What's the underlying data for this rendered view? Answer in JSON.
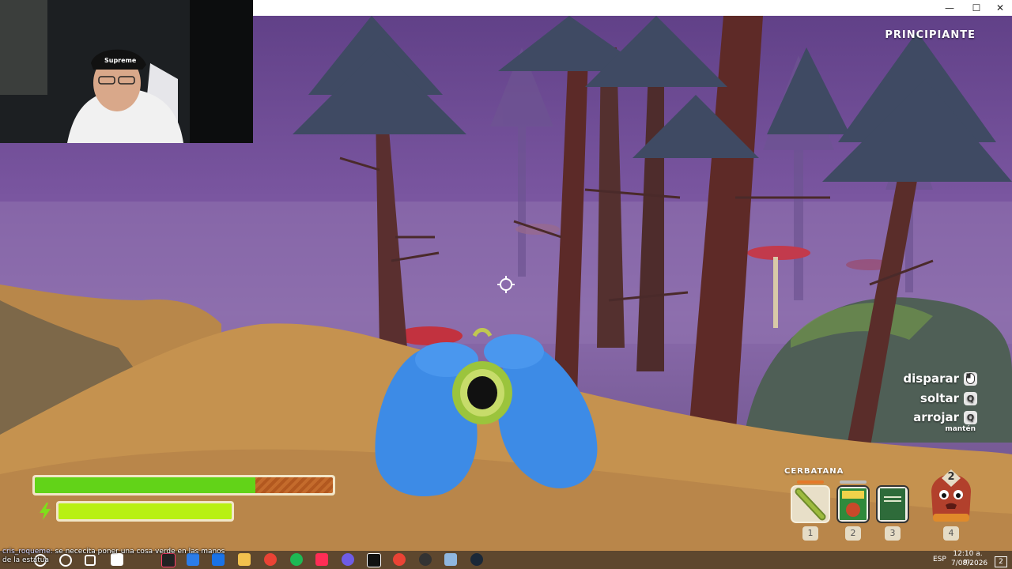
{
  "window": {
    "minimize_glyph": "—",
    "maximize_glyph": "☐",
    "close_glyph": "✕"
  },
  "hud": {
    "difficulty": "PRINCIPIANTE",
    "health_fraction": 0.74,
    "stamina_fraction": 1.0,
    "controls": [
      {
        "label": "disparar",
        "key": "mouse-left-icon"
      },
      {
        "label": "soltar",
        "key": "Q"
      },
      {
        "label": "arrojar",
        "key": "Q",
        "sub": "mantén"
      }
    ],
    "inventory": {
      "selected_name": "CERBATANA",
      "slots": [
        {
          "number": "1",
          "icon": "blowgun-icon",
          "selected": true
        },
        {
          "number": "2",
          "icon": "comic-book-icon",
          "selected": false
        },
        {
          "number": "3",
          "icon": "green-book-icon",
          "selected": false
        },
        {
          "number": "4",
          "icon": "backpack-character-icon",
          "selected": false,
          "count": "2"
        }
      ]
    }
  },
  "chat": {
    "username": "cris_roqueme:",
    "message": "se nececita poner una cosa verde en las manos de la estatua"
  },
  "taskbar": {
    "tray_lang": "ESP",
    "time": "12:10 a. m.",
    "date": "7/08/2026",
    "notification_count": "2"
  }
}
